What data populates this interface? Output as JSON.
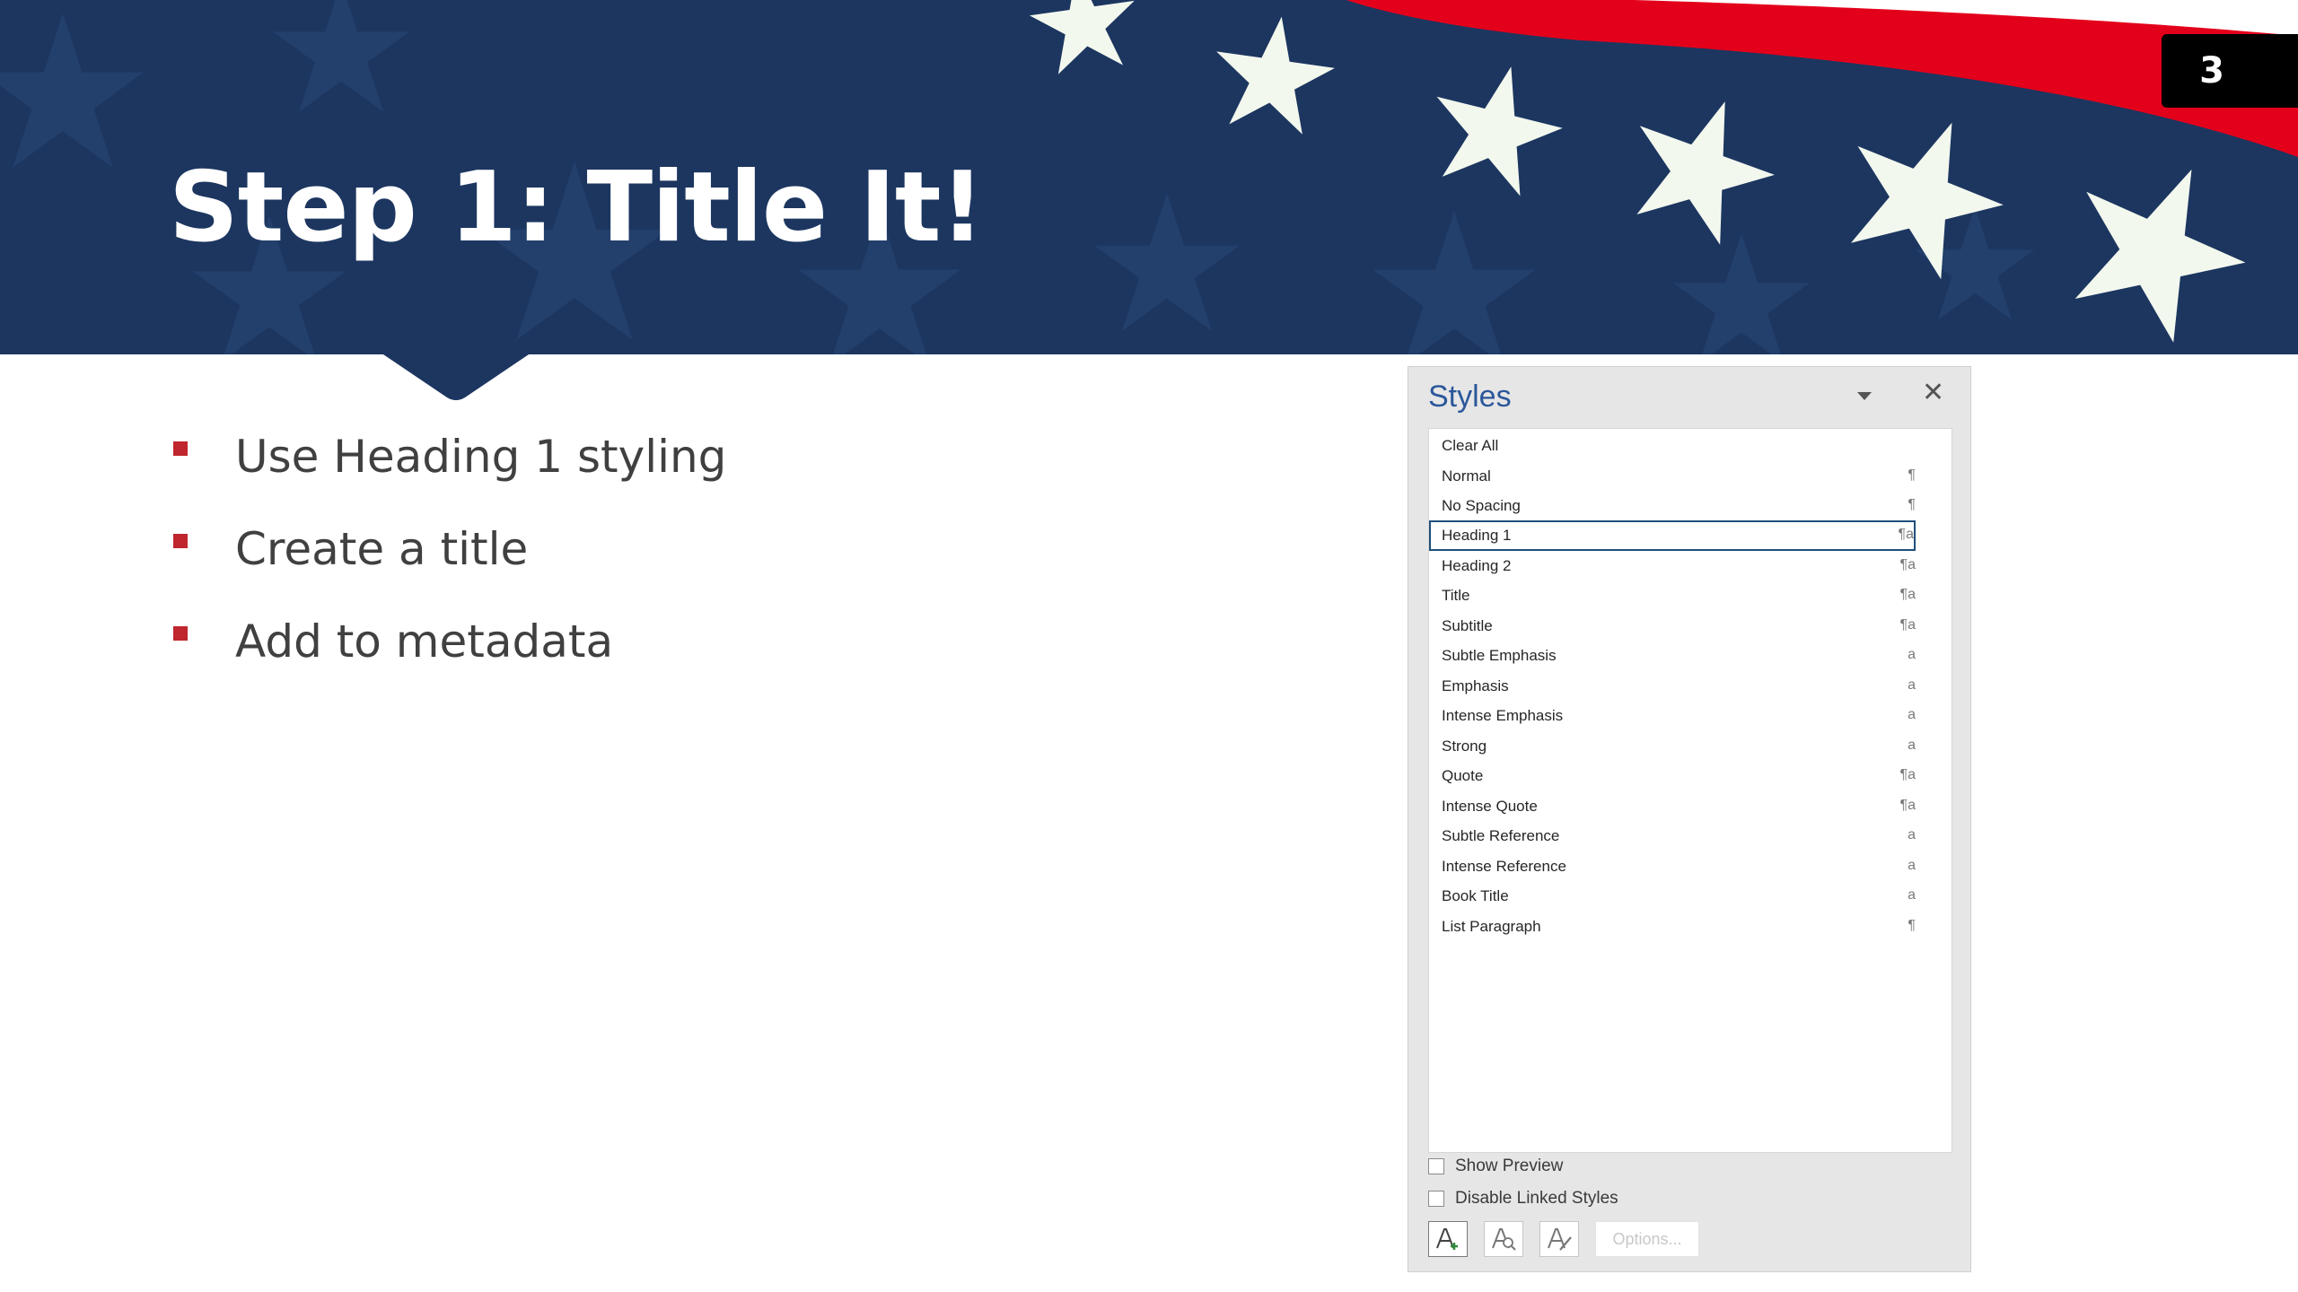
{
  "slide": {
    "title": "Step 1: Title It!",
    "number": "3",
    "bullets": [
      "Use Heading 1 styling",
      "Create a title",
      "Add to metadata"
    ]
  },
  "colors": {
    "banner_navy": "#1c3660",
    "stripe_red": "#e3001b",
    "star_white": "#f3f8ee",
    "bullet_red": "#c0262d",
    "pane_title_blue": "#2b579a"
  },
  "styles_pane": {
    "title": "Styles",
    "dropdown_icon": "chevron-down-icon",
    "close_icon": "close-icon",
    "close_glyph": "✕",
    "items": [
      {
        "label": "Clear All",
        "icon": ""
      },
      {
        "label": "Normal",
        "icon": "¶"
      },
      {
        "label": "No Spacing",
        "icon": "¶"
      },
      {
        "label": "Heading 1",
        "icon": "¶a",
        "selected": true
      },
      {
        "label": "Heading 2",
        "icon": "¶a"
      },
      {
        "label": "Title",
        "icon": "¶a"
      },
      {
        "label": "Subtitle",
        "icon": "¶a"
      },
      {
        "label": "Subtle Emphasis",
        "icon": "a"
      },
      {
        "label": "Emphasis",
        "icon": "a"
      },
      {
        "label": "Intense Emphasis",
        "icon": "a"
      },
      {
        "label": "Strong",
        "icon": "a"
      },
      {
        "label": "Quote",
        "icon": "¶a"
      },
      {
        "label": "Intense Quote",
        "icon": "¶a"
      },
      {
        "label": "Subtle Reference",
        "icon": "a"
      },
      {
        "label": "Intense Reference",
        "icon": "a"
      },
      {
        "label": "Book Title",
        "icon": "a"
      },
      {
        "label": "List Paragraph",
        "icon": "¶"
      }
    ],
    "show_preview": {
      "label": "Show Preview",
      "checked": false
    },
    "disable_linked": {
      "label": "Disable Linked Styles",
      "checked": false
    },
    "toolbar": {
      "new_style_icon": "new-style-icon",
      "style_inspector_icon": "style-inspector-icon",
      "manage_styles_icon": "manage-styles-icon",
      "options_label": "Options..."
    }
  }
}
